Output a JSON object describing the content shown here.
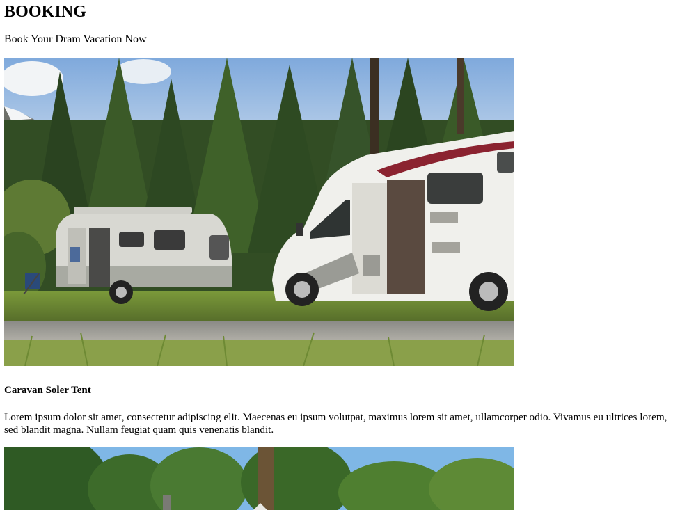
{
  "booking": {
    "heading": "BOOKING",
    "subheading": "Book Your Dram Vacation Now"
  },
  "items": [
    {
      "title": "Caravan Soler Tent",
      "description": "Lorem ipsum dolor sit amet, consectetur adipiscing elit. Maecenas eu ipsum volutpat, maximus lorem sit amet, ullamcorper odio. Vivamus eu ultrices lorem, sed blandit magna. Nullam feugiat quam quis venenatis blandit."
    }
  ],
  "colors": {
    "sky": "#9cc3e6",
    "forest": "#2f4a22",
    "grass": "#6f8f3a",
    "gravel": "#9a9a95",
    "rv_body": "#eeeeea",
    "rv_stripe": "#8b2330"
  }
}
